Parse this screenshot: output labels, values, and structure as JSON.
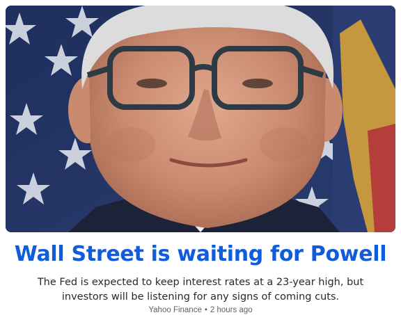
{
  "article": {
    "headline": "Wall Street is waiting for Powell",
    "summary": "The Fed is expected to keep interest rates at a 23-year high, but investors will be listening for any signs of coming cuts.",
    "source": "Yahoo Finance",
    "separator": "•",
    "time_ago": "2 hours ago"
  },
  "colors": {
    "headline": "#0f5cde",
    "summary": "#232a31",
    "meta": "#5b636a"
  }
}
